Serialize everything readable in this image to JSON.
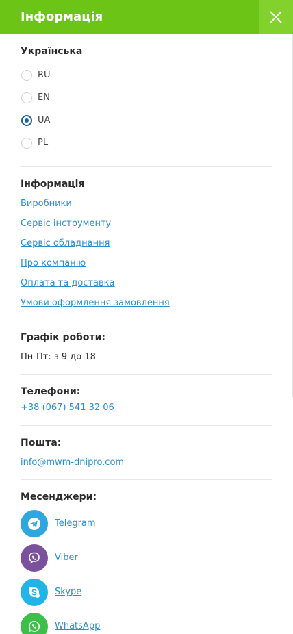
{
  "header": {
    "title": "Інформація",
    "background_color": "#6cc417",
    "close_icon": "close-icon"
  },
  "language": {
    "title": "Українська",
    "options": [
      {
        "label": "RU",
        "selected": false
      },
      {
        "label": "EN",
        "selected": false
      },
      {
        "label": "UA",
        "selected": true
      },
      {
        "label": "PL",
        "selected": false
      }
    ]
  },
  "info": {
    "title": "Інформація",
    "links": [
      "Виробники",
      "Сервіс інструменту",
      "Сервіс обладнання",
      "Про компанію",
      "Оплата та доставка",
      "Умови оформлення замовлення"
    ]
  },
  "schedule": {
    "title": "Графік роботи:",
    "value": "Пн-Пт: з 9 до 18"
  },
  "phones": {
    "title": "Телефони:",
    "value": "+38 (067) 541 32 06"
  },
  "mail": {
    "title": "Пошта:",
    "value": "info@mwm-dnipro.com"
  },
  "messengers": {
    "title": "Месенджери:",
    "items": [
      {
        "label": "Telegram",
        "icon": "telegram-icon",
        "color": "#2fa6dd"
      },
      {
        "label": "Viber",
        "icon": "viber-icon",
        "color": "#7b519d"
      },
      {
        "label": "Skype",
        "icon": "skype-icon",
        "color": "#22b4e8"
      },
      {
        "label": "WhatsApp",
        "icon": "whatsapp-icon",
        "color": "#3cc04a"
      }
    ]
  },
  "colors": {
    "accent": "#6cc417",
    "link": "#2a8fd0",
    "radio_selected": "#1d5fa8"
  }
}
